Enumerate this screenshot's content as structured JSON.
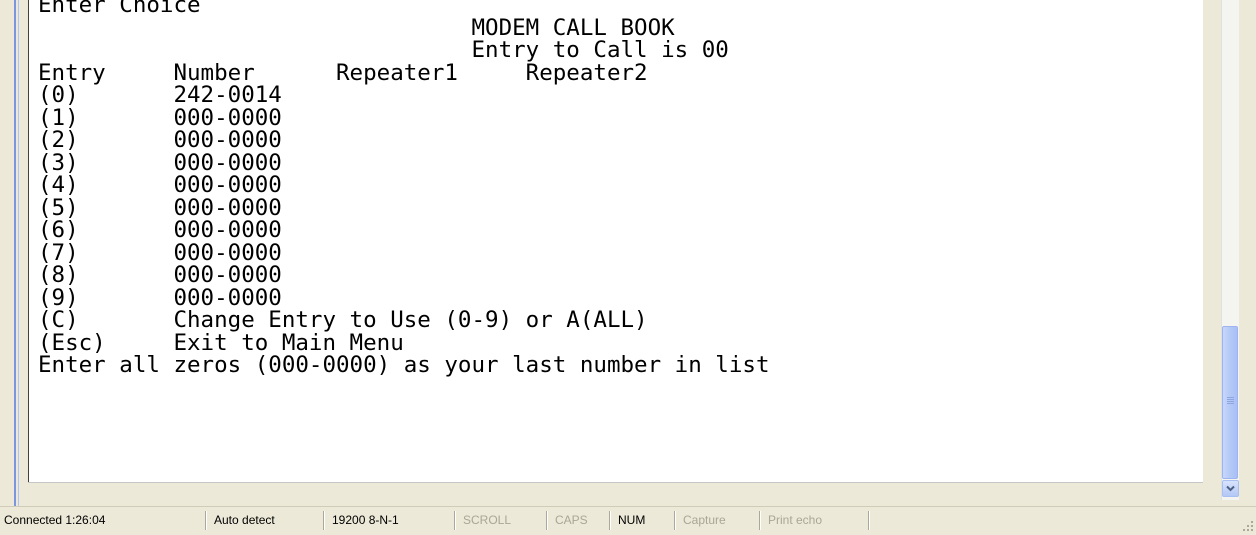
{
  "terminal": {
    "lines": [
      "Enter Choice",
      "                                MODEM CALL BOOK",
      "                                Entry to Call is 00",
      "Entry     Number      Repeater1     Repeater2",
      "(0)       242-0014",
      "(1)       000-0000",
      "(2)       000-0000",
      "(3)       000-0000",
      "(4)       000-0000",
      "(5)       000-0000",
      "(6)       000-0000",
      "(7)       000-0000",
      "(8)       000-0000",
      "(9)       000-0000",
      "(C)       Change Entry to Use (0-9) or A(ALL)",
      "(Esc)     Exit to Main Menu",
      "Enter all zeros (000-0000) as your last number in list"
    ]
  },
  "status_bar": {
    "connected": "Connected 1:26:04",
    "detect": "Auto detect",
    "port_settings": "19200 8-N-1",
    "scroll": "SCROLL",
    "caps": "CAPS",
    "num": "NUM",
    "capture": "Capture",
    "print_echo": "Print echo"
  },
  "colors": {
    "terminal_bg": "#ffffff",
    "chrome_bg": "#ece9d8",
    "scroll_thumb": "#b5c9f7",
    "inactive_indicator": "#a9a696"
  },
  "icons": {
    "scroll_down": "down-arrow-icon",
    "resize": "resize-grip-icon"
  }
}
